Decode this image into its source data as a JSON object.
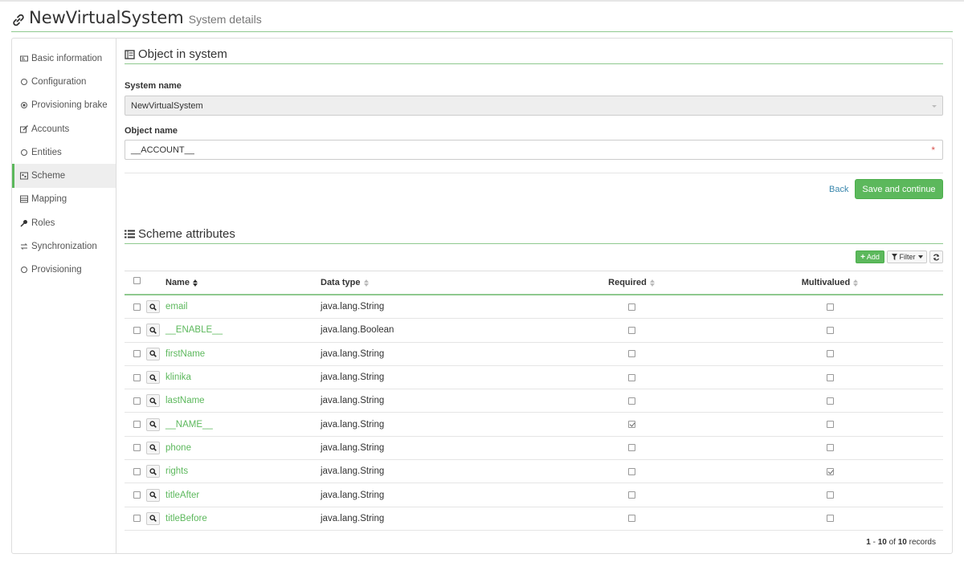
{
  "header": {
    "title": "NewVirtualSystem",
    "subtitle": "System details"
  },
  "sidebar": {
    "items": [
      {
        "label": "Basic information",
        "icon": "card-icon"
      },
      {
        "label": "Configuration",
        "icon": "circle-icon"
      },
      {
        "label": "Provisioning brake",
        "icon": "record-icon"
      },
      {
        "label": "Accounts",
        "icon": "edit-icon"
      },
      {
        "label": "Entities",
        "icon": "circle-icon"
      },
      {
        "label": "Scheme",
        "icon": "schema-icon",
        "active": true
      },
      {
        "label": "Mapping",
        "icon": "list-icon"
      },
      {
        "label": "Roles",
        "icon": "key-icon"
      },
      {
        "label": "Synchronization",
        "icon": "transfer-icon"
      },
      {
        "label": "Provisioning",
        "icon": "circle-icon"
      }
    ]
  },
  "object_section": {
    "title": "Object in system",
    "system_name_label": "System name",
    "system_name_value": "NewVirtualSystem",
    "object_name_label": "Object name",
    "object_name_value": "__ACCOUNT__",
    "required_mark": "*",
    "back_label": "Back",
    "save_label": "Save and continue"
  },
  "scheme_section": {
    "title": "Scheme attributes",
    "add_label": "Add",
    "filter_label": "Filter"
  },
  "table": {
    "columns": {
      "name": "Name",
      "type": "Data type",
      "required": "Required",
      "multivalued": "Multivalued"
    },
    "rows": [
      {
        "name": "email",
        "type": "java.lang.String",
        "required": false,
        "multivalued": false
      },
      {
        "name": "__ENABLE__",
        "type": "java.lang.Boolean",
        "required": false,
        "multivalued": false
      },
      {
        "name": "firstName",
        "type": "java.lang.String",
        "required": false,
        "multivalued": false
      },
      {
        "name": "klinika",
        "type": "java.lang.String",
        "required": false,
        "multivalued": false
      },
      {
        "name": "lastName",
        "type": "java.lang.String",
        "required": false,
        "multivalued": false
      },
      {
        "name": "__NAME__",
        "type": "java.lang.String",
        "required": true,
        "multivalued": false
      },
      {
        "name": "phone",
        "type": "java.lang.String",
        "required": false,
        "multivalued": false
      },
      {
        "name": "rights",
        "type": "java.lang.String",
        "required": false,
        "multivalued": true
      },
      {
        "name": "titleAfter",
        "type": "java.lang.String",
        "required": false,
        "multivalued": false
      },
      {
        "name": "titleBefore",
        "type": "java.lang.String",
        "required": false,
        "multivalued": false
      }
    ]
  },
  "pagination": {
    "from": "1",
    "to": "10",
    "of_label": "of",
    "total": "10",
    "records_label": "records"
  },
  "colors": {
    "accent": "#5cb85c",
    "link": "#3a87ad",
    "required": "#d9534f"
  }
}
